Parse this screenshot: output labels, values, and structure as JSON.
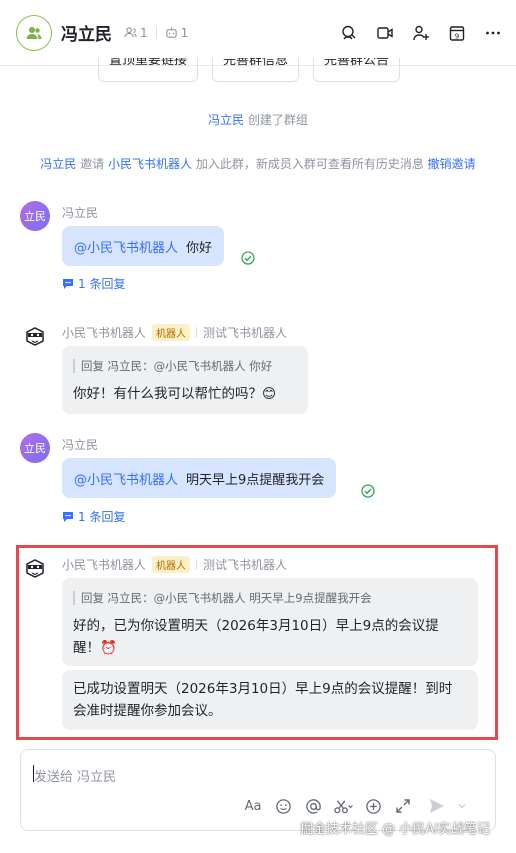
{
  "header": {
    "title": "冯立民",
    "member_count": "1",
    "bot_count": "1"
  },
  "top_buttons": [
    "置顶重要链接",
    "完善群信息",
    "完善群公告"
  ],
  "system": {
    "created_name": "冯立民",
    "created_text": "创建了群组",
    "invite_actor": "冯立民",
    "invite_verb": "邀请",
    "invite_target": "小民飞书机器人",
    "invite_text": "加入此群，新成员入群可查看所有历史消息",
    "revoke_label": "撤销邀请"
  },
  "messages": [
    {
      "avatar_text": "立民",
      "sender": "冯立民",
      "mention": "@小民飞书机器人",
      "text": "你好",
      "reply_label": "1 条回复"
    },
    {
      "sender": "小民飞书机器人",
      "tag": "机器人",
      "group_label": "测试飞书机器人",
      "quote": "回复 冯立民：@小民飞书机器人 你好",
      "text": "你好！有什么我可以帮忙的吗？😊"
    },
    {
      "avatar_text": "立民",
      "sender": "冯立民",
      "mention": "@小民飞书机器人",
      "text": "明天早上9点提醒我开会",
      "reply_label": "1 条回复"
    },
    {
      "sender": "小民飞书机器人",
      "tag": "机器人",
      "group_label": "测试飞书机器人",
      "quote": "回复 冯立民：@小民飞书机器人 明天早上9点提醒我开会",
      "text_line1": "好的，已为你设置明天（2026年3月10日）早上9点的会议提",
      "text_line2": "醒！⏰",
      "text2_line1": "已成功设置明天（2026年3月10日）早上9点的会议提醒！到时",
      "text2_line2": "会准时提醒你参加会议。"
    }
  ],
  "input": {
    "placeholder": "发送给 冯立民",
    "font_tool": "Aa"
  },
  "watermark": "掘金技术社区 @ 小民AI实战笔记",
  "colors": {
    "accent": "#3370ff",
    "highlight": "#e5484d",
    "bubble_self": "#d7e4ff",
    "bubble_bot": "#eff0f1"
  }
}
